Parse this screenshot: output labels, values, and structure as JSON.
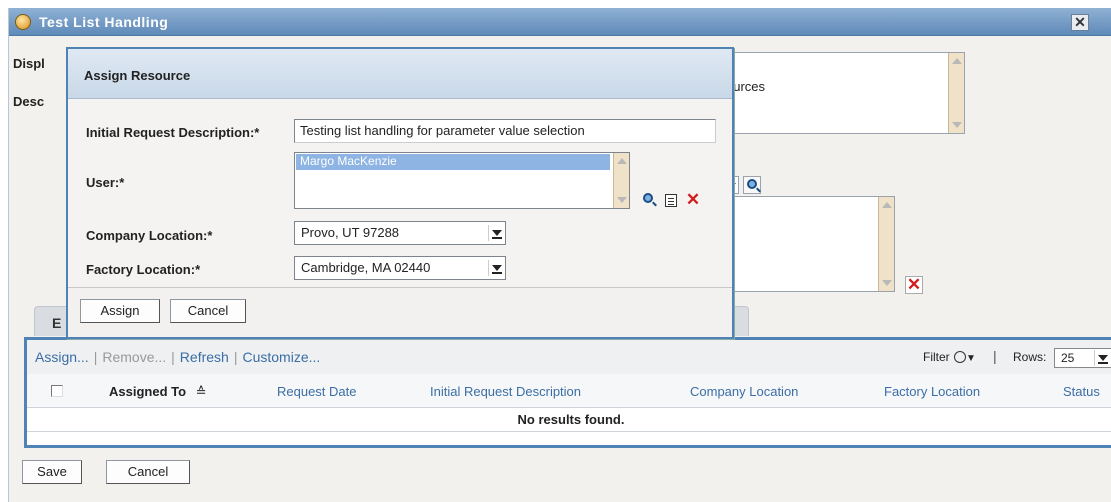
{
  "window": {
    "title": "Test List Handling",
    "close_glyph": "✕"
  },
  "background_form": {
    "display_label_fragment": "Displ",
    "description_label_fragment": "Desc",
    "description_text_fragment": "ources"
  },
  "modal": {
    "title": "Assign Resource",
    "fields": {
      "initial_request_label": "Initial Request Description:*",
      "initial_request_value": "Testing list handling for parameter value selection",
      "user_label": "User:*",
      "user_selected": "Margo MacKenzie",
      "company_location_label": "Company Location:*",
      "company_location_value": "Provo, UT 97288",
      "factory_location_label": "Factory Location:*",
      "factory_location_value": "Cambridge, MA 02440"
    },
    "buttons": {
      "assign": "Assign",
      "cancel": "Cancel"
    }
  },
  "assignments": {
    "tab_fragment": "E",
    "actions": {
      "assign": "Assign...",
      "remove": "Remove...",
      "refresh": "Refresh",
      "customize": "Customize..."
    },
    "filter_label": "Filter",
    "rows_label": "Rows:",
    "rows_value": "25",
    "columns": [
      "Assigned To",
      "Request Date",
      "Initial Request Description",
      "Company Location",
      "Factory Location",
      "Status"
    ],
    "sort_glyph": "≙",
    "empty_message": "No results found."
  },
  "footer": {
    "save": "Save",
    "cancel": "Cancel"
  }
}
